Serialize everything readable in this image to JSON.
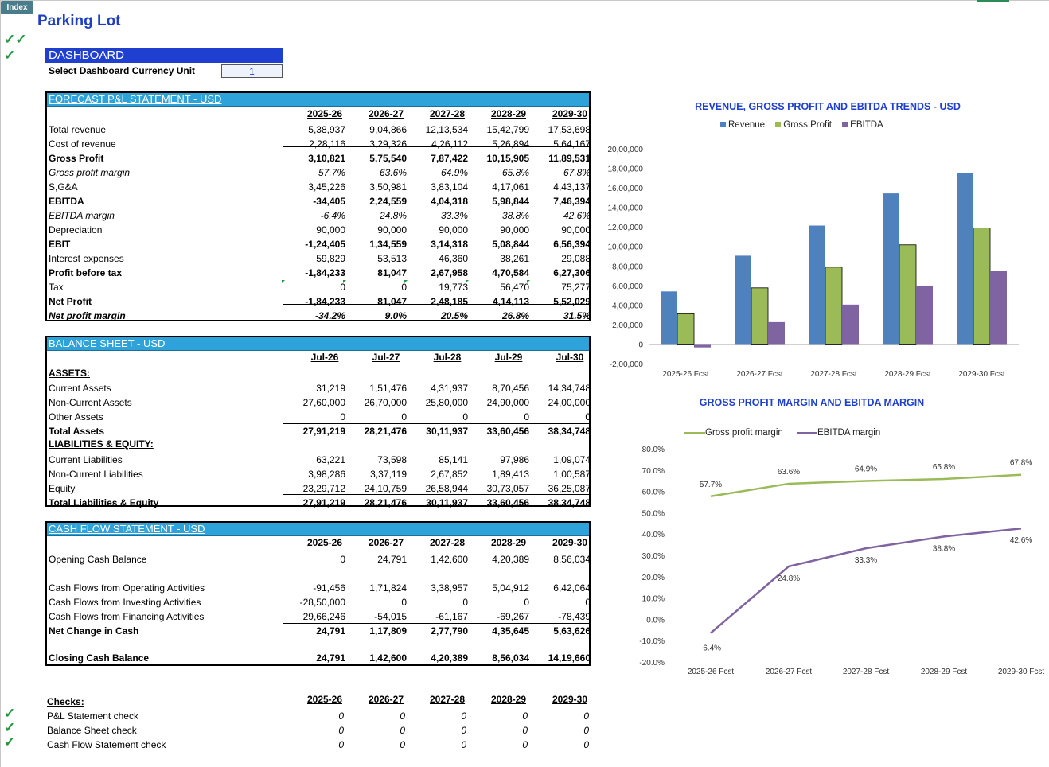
{
  "index_label": "Index",
  "title": "Parking Lot",
  "dashboard": {
    "header": "DASHBOARD",
    "currency_label": "Select Dashboard Currency Unit",
    "currency_value": "1"
  },
  "years": [
    "2025-26",
    "2026-27",
    "2027-28",
    "2028-29",
    "2029-30"
  ],
  "pl": {
    "header": "FORECAST P&L STATEMENT - USD",
    "rows": [
      {
        "label": "Total revenue",
        "values": [
          "5,38,937",
          "9,04,866",
          "12,13,534",
          "15,42,799",
          "17,53,698"
        ],
        "style": ""
      },
      {
        "label": "Cost of revenue",
        "values": [
          "2,28,116",
          "3,29,326",
          "4,26,112",
          "5,26,894",
          "5,64,167"
        ],
        "style": ""
      },
      {
        "label": "Gross Profit",
        "values": [
          "3,10,821",
          "5,75,540",
          "7,87,422",
          "10,15,905",
          "11,89,531"
        ],
        "style": "b"
      },
      {
        "label": "Gross profit margin",
        "values": [
          "57.7%",
          "63.6%",
          "64.9%",
          "65.8%",
          "67.8%"
        ],
        "style": "i"
      },
      {
        "label": "S,G&A",
        "values": [
          "3,45,226",
          "3,50,981",
          "3,83,104",
          "4,17,061",
          "4,43,137"
        ],
        "style": ""
      },
      {
        "label": "EBITDA",
        "values": [
          "-34,405",
          "2,24,559",
          "4,04,318",
          "5,98,844",
          "7,46,394"
        ],
        "style": "b"
      },
      {
        "label": "EBITDA margin",
        "values": [
          "-6.4%",
          "24.8%",
          "33.3%",
          "38.8%",
          "42.6%"
        ],
        "style": "i"
      },
      {
        "label": "Depreciation",
        "values": [
          "90,000",
          "90,000",
          "90,000",
          "90,000",
          "90,000"
        ],
        "style": ""
      },
      {
        "label": "EBIT",
        "values": [
          "-1,24,405",
          "1,34,559",
          "3,14,318",
          "5,08,844",
          "6,56,394"
        ],
        "style": "b"
      },
      {
        "label": "Interest expenses",
        "values": [
          "59,829",
          "53,513",
          "46,360",
          "38,261",
          "29,088"
        ],
        "style": ""
      },
      {
        "label": "Profit before tax",
        "values": [
          "-1,84,233",
          "81,047",
          "2,67,958",
          "4,70,584",
          "6,27,306"
        ],
        "style": "b"
      },
      {
        "label": "Tax",
        "values": [
          "0",
          "0",
          "19,773",
          "56,470",
          "75,277"
        ],
        "style": ""
      },
      {
        "label": "Net Profit",
        "values": [
          "-1,84,233",
          "81,047",
          "2,48,185",
          "4,14,113",
          "5,52,029"
        ],
        "style": "b"
      },
      {
        "label": "Net profit margin",
        "values": [
          "-34.2%",
          "9.0%",
          "20.5%",
          "26.8%",
          "31.5%"
        ],
        "style": "b i"
      }
    ]
  },
  "bs": {
    "header": "BALANCE SHEET - USD",
    "periods": [
      "Jul-26",
      "Jul-27",
      "Jul-28",
      "Jul-29",
      "Jul-30"
    ],
    "assets_label": "ASSETS:",
    "liab_label": "LIABILITIES & EQUITY:",
    "assets": [
      {
        "label": "Current Assets",
        "values": [
          "31,219",
          "1,51,476",
          "4,31,937",
          "8,70,456",
          "14,34,748"
        ],
        "style": ""
      },
      {
        "label": "Non-Current Assets",
        "values": [
          "27,60,000",
          "26,70,000",
          "25,80,000",
          "24,90,000",
          "24,00,000"
        ],
        "style": ""
      },
      {
        "label": "Other Assets",
        "values": [
          "0",
          "0",
          "0",
          "0",
          "0"
        ],
        "style": ""
      },
      {
        "label": "Total Assets",
        "values": [
          "27,91,219",
          "28,21,476",
          "30,11,937",
          "33,60,456",
          "38,34,748"
        ],
        "style": "b"
      }
    ],
    "liabilities": [
      {
        "label": "Current Liabilities",
        "values": [
          "63,221",
          "73,598",
          "85,141",
          "97,986",
          "1,09,074"
        ],
        "style": ""
      },
      {
        "label": "Non-Current Liabilities",
        "values": [
          "3,98,286",
          "3,37,119",
          "2,67,852",
          "1,89,413",
          "1,00,587"
        ],
        "style": ""
      },
      {
        "label": "Equity",
        "values": [
          "23,29,712",
          "24,10,759",
          "26,58,944",
          "30,73,057",
          "36,25,087"
        ],
        "style": ""
      },
      {
        "label": "Total Liabilities & Equity",
        "values": [
          "27,91,219",
          "28,21,476",
          "30,11,937",
          "33,60,456",
          "38,34,748"
        ],
        "style": "b"
      }
    ]
  },
  "cf": {
    "header": "CASH FLOW STATEMENT -  USD",
    "rows": [
      {
        "label": "Opening Cash Balance",
        "values": [
          "0",
          "24,791",
          "1,42,600",
          "4,20,389",
          "8,56,034"
        ],
        "style": ""
      },
      {
        "label": "Cash Flows from Operating Activities",
        "values": [
          "-91,456",
          "1,71,824",
          "3,38,957",
          "5,04,912",
          "6,42,064"
        ],
        "style": ""
      },
      {
        "label": "Cash Flows from Investing Activities",
        "values": [
          "-28,50,000",
          "0",
          "0",
          "0",
          "0"
        ],
        "style": ""
      },
      {
        "label": "Cash Flows from Financing Activities",
        "values": [
          "29,66,246",
          "-54,015",
          "-61,167",
          "-69,267",
          "-78,439"
        ],
        "style": ""
      },
      {
        "label": "Net Change in Cash",
        "values": [
          "24,791",
          "1,17,809",
          "2,77,790",
          "4,35,645",
          "5,63,626"
        ],
        "style": "b"
      },
      {
        "label": "Closing Cash Balance",
        "values": [
          "24,791",
          "1,42,600",
          "4,20,389",
          "8,56,034",
          "14,19,660"
        ],
        "style": "b"
      }
    ]
  },
  "checks": {
    "header": "Checks:",
    "rows": [
      {
        "label": "P&L Statement check",
        "values": [
          "0",
          "0",
          "0",
          "0",
          "0"
        ]
      },
      {
        "label": "Balance Sheet check",
        "values": [
          "0",
          "0",
          "0",
          "0",
          "0"
        ]
      },
      {
        "label": "Cash Flow Statement check",
        "values": [
          "0",
          "0",
          "0",
          "0",
          "0"
        ]
      }
    ]
  },
  "colors": {
    "revenue": "#4f81bd",
    "gross_profit": "#9bbb59",
    "ebitda": "#8064a2",
    "header_blue": "#2ea3d9",
    "dash_blue": "#1f3fd0"
  },
  "chart_data": [
    {
      "type": "bar",
      "title": "REVENUE, GROSS PROFIT AND EBITDA TRENDS - USD",
      "categories": [
        "2025-26 Fcst",
        "2026-27 Fcst",
        "2027-28 Fcst",
        "2028-29 Fcst",
        "2029-30 Fcst"
      ],
      "series": [
        {
          "name": "Revenue",
          "values": [
            538937,
            904866,
            1213534,
            1542799,
            1753698
          ]
        },
        {
          "name": "Gross Profit",
          "values": [
            310821,
            575540,
            787422,
            1015905,
            1189531
          ]
        },
        {
          "name": "EBITDA",
          "values": [
            -34405,
            224559,
            404318,
            598844,
            746394
          ]
        }
      ],
      "ylim": [
        -200000,
        2000000
      ],
      "yticks": [
        "20,00,000",
        "18,00,000",
        "16,00,000",
        "14,00,000",
        "12,00,000",
        "10,00,000",
        "8,00,000",
        "6,00,000",
        "4,00,000",
        "2,00,000",
        "0",
        "-2,00,000"
      ],
      "legend": "top"
    },
    {
      "type": "line",
      "title": "GROSS PROFIT MARGIN AND EBITDA MARGIN",
      "categories": [
        "2025-26 Fcst",
        "2026-27 Fcst",
        "2027-28 Fcst",
        "2028-29 Fcst",
        "2029-30 Fcst"
      ],
      "series": [
        {
          "name": "Gross profit margin",
          "values": [
            57.7,
            63.6,
            64.9,
            65.8,
            67.8
          ],
          "labels": [
            "57.7%",
            "63.6%",
            "64.9%",
            "65.8%",
            "67.8%"
          ]
        },
        {
          "name": "EBITDA margin",
          "values": [
            -6.4,
            24.8,
            33.3,
            38.8,
            42.6
          ],
          "labels": [
            "-6.4%",
            "24.8%",
            "33.3%",
            "38.8%",
            "42.6%"
          ]
        }
      ],
      "ylim": [
        -20,
        80
      ],
      "yticks": [
        "80.0%",
        "70.0%",
        "60.0%",
        "50.0%",
        "40.0%",
        "30.0%",
        "20.0%",
        "10.0%",
        "0.0%",
        "-10.0%",
        "-20.0%"
      ],
      "legend": "top"
    }
  ]
}
